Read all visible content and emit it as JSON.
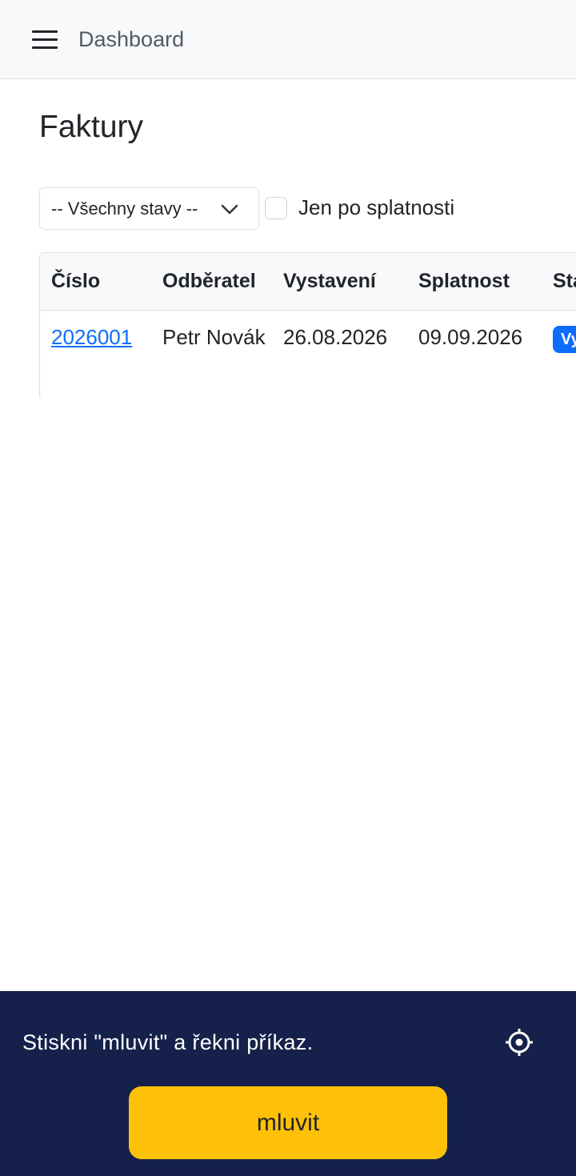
{
  "navbar": {
    "menu_icon": "hamburger-icon",
    "brand": "Dashboard"
  },
  "page": {
    "title": "Faktury"
  },
  "filters": {
    "status_select": {
      "selected": "-- Všechny stavy --",
      "icon": "chevron-down-icon"
    },
    "overdue_checkbox": {
      "label": "Jen po splatnosti",
      "checked": false
    }
  },
  "invoices_table": {
    "columns": [
      "Číslo",
      "Odběratel",
      "Vystavení",
      "Splatnost",
      "Stav"
    ],
    "rows": [
      {
        "number": "2026001",
        "customer": "Petr Novák",
        "issued": "26.08.2026",
        "due": "09.09.2026",
        "status": "Vystavena"
      }
    ]
  },
  "voice_panel": {
    "hint": "Stiskni \"mluvit\" a řekni příkaz.",
    "settings_icon": "gear-icon",
    "talk_button": "mluvit",
    "colors": {
      "background": "#15214a",
      "button": "#ffc107"
    }
  },
  "colors": {
    "link": "#0d6efd",
    "badge": "#0d6efd"
  }
}
